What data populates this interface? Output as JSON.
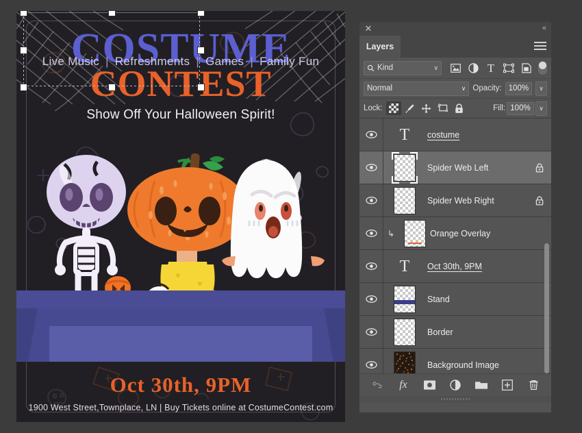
{
  "panel": {
    "close_label": "✕",
    "collapse_label": "«",
    "tab_label": "Layers",
    "menu_icon": "hamburger-menu-icon",
    "filter": {
      "kind_label": "Kind",
      "search_icon": "search-icon",
      "chevron": "∨",
      "icons": [
        "image-filter-icon",
        "adjustment-filter-icon",
        "type-filter-icon",
        "shape-filter-icon",
        "smart-object-filter-icon"
      ],
      "toggle_icon": "filter-toggle-switch"
    },
    "blend": {
      "mode": "Normal",
      "chevron": "∨",
      "opacity_label": "Opacity:",
      "opacity_value": "100%"
    },
    "lock": {
      "label": "Lock:",
      "icons": [
        "lock-transparent-pixels-icon",
        "lock-image-pixels-icon",
        "lock-position-icon",
        "lock-artboard-icon",
        "lock-all-icon"
      ],
      "fill_label": "Fill:",
      "fill_value": "100%"
    },
    "layers": [
      {
        "name": "costume",
        "type": "text",
        "visible": true,
        "selected": false,
        "locked": false,
        "underline": true
      },
      {
        "name": "Spider Web Left",
        "type": "pixel",
        "visible": true,
        "selected": true,
        "locked": true,
        "underline": false
      },
      {
        "name": "Spider Web Right",
        "type": "pixel",
        "visible": true,
        "selected": false,
        "locked": true,
        "underline": false
      },
      {
        "name": "Orange Overlay",
        "type": "clipped",
        "visible": true,
        "selected": false,
        "locked": false,
        "underline": false
      },
      {
        "name": "Oct 30th, 9PM",
        "type": "text",
        "visible": true,
        "selected": false,
        "locked": false,
        "underline": true
      },
      {
        "name": "Stand",
        "type": "stand",
        "visible": true,
        "selected": false,
        "locked": false,
        "underline": false
      },
      {
        "name": "Border",
        "type": "pixel",
        "visible": true,
        "selected": false,
        "locked": false,
        "underline": false
      },
      {
        "name": "Background Image",
        "type": "bgimage",
        "visible": true,
        "selected": false,
        "locked": false,
        "underline": false
      }
    ],
    "bottom_icons": [
      "link-layers-icon",
      "layer-effects-fx-icon",
      "add-layer-mask-icon",
      "new-adjustment-layer-icon",
      "new-group-folder-icon",
      "new-layer-icon",
      "delete-layer-trash-icon"
    ]
  },
  "poster": {
    "title_line1": "COSTUME",
    "title_line2": "CONTEST",
    "subtitle": "Show Off Your Halloween Spirit!",
    "features": [
      "Live Music",
      "Refreshments",
      "Games",
      "Family Fun"
    ],
    "feature_separator": "|",
    "date": "Oct 30th, 9PM",
    "address": "1900 West Street,Townplace, LN  |  Buy Tickets online at CostumeContest.com",
    "colors": {
      "background": "#221f24",
      "title_blue": "#5b5fcf",
      "title_orange": "#e8622a",
      "stand_purple": "#474a90",
      "stand_plate": "#5a5da8"
    }
  }
}
